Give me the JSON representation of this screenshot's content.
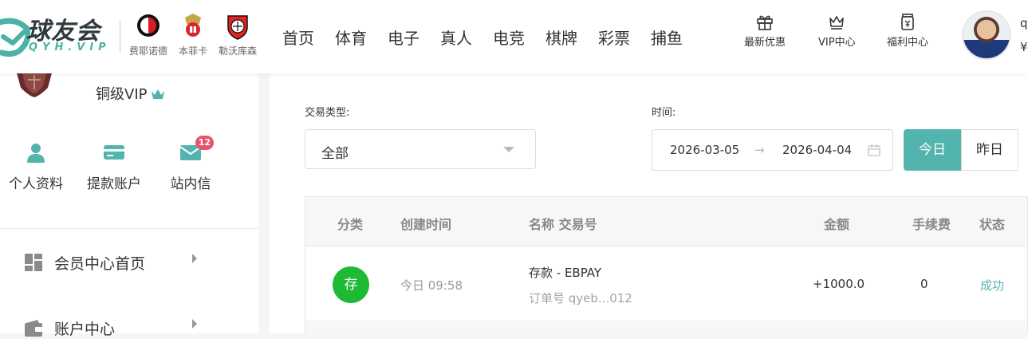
{
  "brand": {
    "name": "球友会",
    "sub": "QYH.VIP",
    "colors": {
      "accent": "#53b4ad",
      "green": "#1dbb33",
      "badge": "#e8536f"
    }
  },
  "partners": [
    {
      "label": "费耶诺德",
      "icon": "feyenoord-crest-icon"
    },
    {
      "label": "本菲卡",
      "icon": "benfica-crest-icon"
    },
    {
      "label": "勒沃库森",
      "icon": "leverkusen-crest-icon"
    }
  ],
  "nav": [
    "首页",
    "体育",
    "电子",
    "真人",
    "电竞",
    "棋牌",
    "彩票",
    "捕鱼"
  ],
  "quick_links": [
    {
      "label": "最新优惠",
      "icon": "gift-icon"
    },
    {
      "label": "VIP中心",
      "icon": "crown-icon"
    },
    {
      "label": "福利中心",
      "icon": "jar-icon"
    }
  ],
  "user": {
    "name": "q",
    "balance": "¥"
  },
  "sidebar": {
    "vip_level": "铜级VIP",
    "actions": [
      {
        "label": "个人资料",
        "icon": "user-icon"
      },
      {
        "label": "提款账户",
        "icon": "card-icon"
      },
      {
        "label": "站内信",
        "icon": "mail-icon",
        "badge": "12"
      }
    ],
    "menu": [
      {
        "label": "会员中心首页",
        "icon": "dashboard-icon"
      },
      {
        "label": "账户中心",
        "icon": "wallet-icon"
      }
    ]
  },
  "filters": {
    "type_label": "交易类型:",
    "type_value": "全部",
    "time_label": "时间:",
    "date_start": "2026-03-05",
    "date_sep": "→",
    "date_end": "2026-04-04",
    "range_buttons": [
      "今日",
      "昨日"
    ]
  },
  "table": {
    "headers": [
      "分类",
      "创建时间",
      "名称 交易号",
      "金额",
      "手续费",
      "状态"
    ],
    "rows": [
      {
        "category": "存",
        "time": "今日 09:58",
        "name": "存款 - EBPAY",
        "order": "订单号 qyeb...012",
        "amount": "+1000.0",
        "fee": "0",
        "status": "成功"
      }
    ]
  }
}
